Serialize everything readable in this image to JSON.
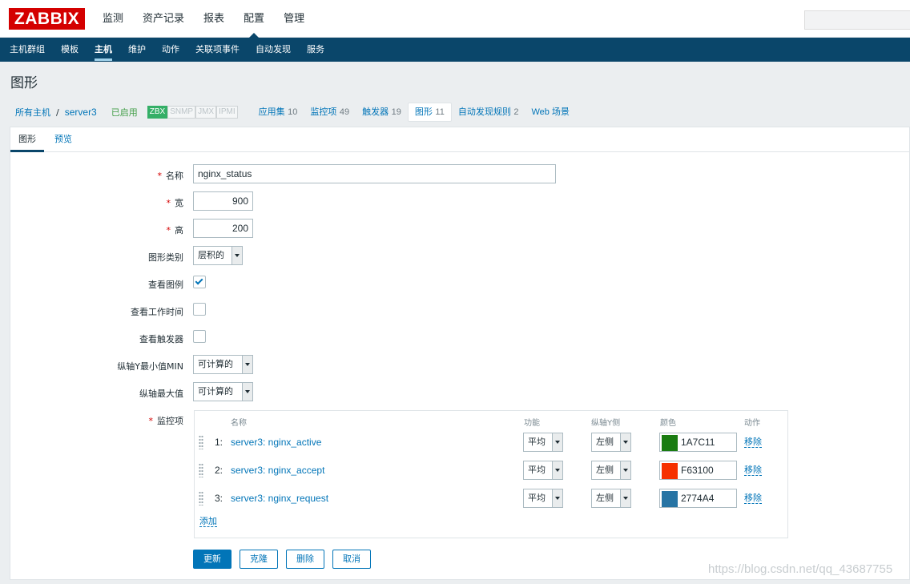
{
  "logo": "ZABBIX",
  "main_menu": [
    "监测",
    "资产记录",
    "报表",
    "配置",
    "管理"
  ],
  "main_menu_active": "配置",
  "sub_menu": [
    "主机群组",
    "模板",
    "主机",
    "维护",
    "动作",
    "关联项事件",
    "自动发现",
    "服务"
  ],
  "sub_menu_active": "主机",
  "page_title": "图形",
  "breadcrumb": {
    "all_hosts": "所有主机",
    "separator": "/",
    "host": "server3",
    "status": "已启用",
    "badges": [
      "ZBX",
      "SNMP",
      "JMX",
      "IPMI"
    ],
    "tabs": [
      {
        "label": "应用集",
        "count": "10"
      },
      {
        "label": "监控项",
        "count": "49"
      },
      {
        "label": "触发器",
        "count": "19"
      },
      {
        "label": "图形",
        "count": "11"
      },
      {
        "label": "自动发现规则",
        "count": "2"
      },
      {
        "label": "Web 场景",
        "count": ""
      }
    ]
  },
  "form_tabs": [
    "图形",
    "预览"
  ],
  "form": {
    "name_label": "名称",
    "name_value": "nginx_status",
    "width_label": "宽",
    "width_value": "900",
    "height_label": "高",
    "height_value": "200",
    "graph_type_label": "图形类别",
    "graph_type_value": "层积的",
    "show_legend_label": "查看图例",
    "show_legend_checked": true,
    "show_working_time_label": "查看工作时间",
    "show_working_time_checked": false,
    "show_triggers_label": "查看触发器",
    "show_triggers_checked": false,
    "ymin_label": "纵轴Y最小值MIN",
    "ymin_value": "可计算的",
    "ymax_label": "纵轴最大值",
    "ymax_value": "可计算的",
    "items_label": "监控项"
  },
  "items_table": {
    "headers": {
      "name": "名称",
      "function": "功能",
      "axis": "纵轴Y侧",
      "color": "颜色",
      "action": "动作"
    },
    "rows": [
      {
        "num": "1:",
        "name": "server3: nginx_active",
        "function": "平均",
        "axis": "左侧",
        "color": "1A7C11",
        "remove": "移除"
      },
      {
        "num": "2:",
        "name": "server3: nginx_accept",
        "function": "平均",
        "axis": "左侧",
        "color": "F63100",
        "remove": "移除"
      },
      {
        "num": "3:",
        "name": "server3: nginx_request",
        "function": "平均",
        "axis": "左侧",
        "color": "2774A4",
        "remove": "移除"
      }
    ],
    "add_label": "添加"
  },
  "buttons": {
    "update": "更新",
    "clone": "克隆",
    "delete": "删除",
    "cancel": "取消"
  },
  "watermark": "https://blog.csdn.net/qq_43687755"
}
